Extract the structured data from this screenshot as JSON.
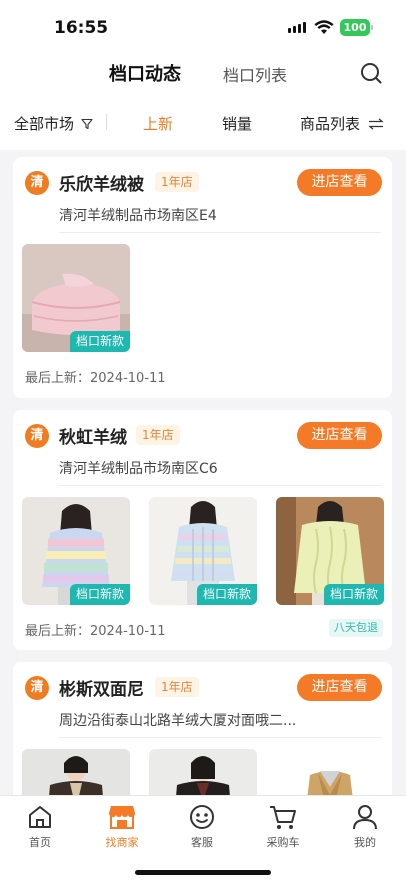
{
  "status_bar": {
    "time": "16:55",
    "battery": "100"
  },
  "header": {
    "tabs": [
      {
        "label": "档口动态",
        "active": true
      },
      {
        "label": "档口列表",
        "active": false
      }
    ],
    "search_icon": "search-icon"
  },
  "filters": {
    "market": "全部市场",
    "items": [
      {
        "label": "上新",
        "active": true
      },
      {
        "label": "销量",
        "active": false
      }
    ],
    "product_list": "商品列表"
  },
  "shops": [
    {
      "badge": "清",
      "name": "乐欣羊绒被",
      "years": "1年店",
      "button": "进店查看",
      "address": "清河羊绒制品市场南区E4",
      "products": [
        {
          "tag": "档口新款",
          "image": "pink-quilt"
        }
      ],
      "last_update": "最后上新：2024-10-11"
    },
    {
      "badge": "清",
      "name": "秋虹羊绒",
      "years": "1年店",
      "button": "进店查看",
      "address": "清河羊绒制品市场南区C6",
      "products": [
        {
          "tag": "档口新款",
          "image": "rainbow-sweater"
        },
        {
          "tag": "档口新款",
          "image": "pastel-cable-sweater"
        },
        {
          "tag": "档口新款",
          "image": "yellow-cable-sweater"
        }
      ],
      "last_update": "最后上新：2024-10-11",
      "shipping": "八天包退"
    },
    {
      "badge": "清",
      "name": "彬斯双面尼",
      "years": "1年店",
      "button": "进店查看",
      "address": "周边沿街泰山北路羊绒大厦对面哦二...",
      "products": [
        {
          "image": "dark-coat"
        },
        {
          "image": "black-coat"
        },
        {
          "image": "tan-coat"
        }
      ]
    }
  ],
  "bottom_nav": [
    {
      "label": "首页",
      "icon": "home-icon",
      "active": false
    },
    {
      "label": "找商家",
      "icon": "store-icon",
      "active": true
    },
    {
      "label": "客服",
      "icon": "service-icon",
      "active": false
    },
    {
      "label": "采购车",
      "icon": "cart-icon",
      "active": false
    },
    {
      "label": "我的",
      "icon": "profile-icon",
      "active": false
    }
  ],
  "colors": {
    "accent": "#f57a27",
    "teal": "#1fb8b0"
  }
}
